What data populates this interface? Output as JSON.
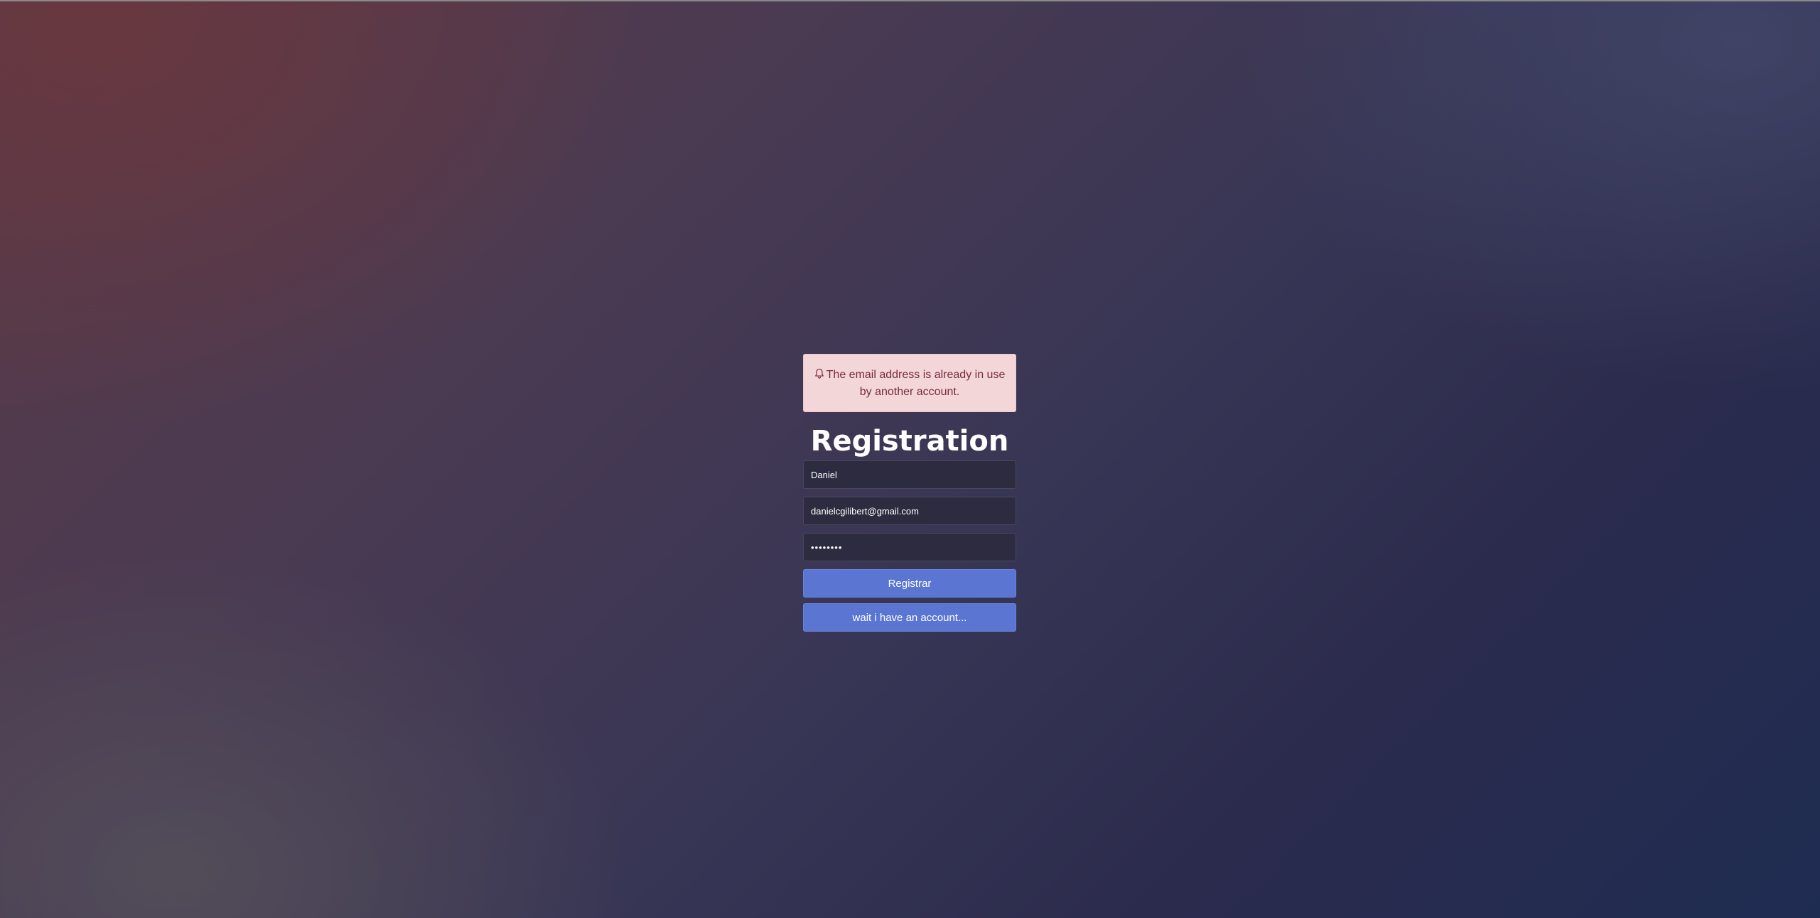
{
  "alert": {
    "icon": "bell-icon",
    "message": "The email address is already in use by another account."
  },
  "form": {
    "title": "Registration",
    "name_value": "Daniel",
    "email_value": "danielcgilibert@gmail.com",
    "password_value": "••••••••",
    "register_label": "Registrar",
    "login_label": "wait i have an account..."
  },
  "colors": {
    "alert_bg": "#f2d6d8",
    "alert_text": "#7a2b3a",
    "button_bg": "#5a76d2",
    "input_bg": "#2d2b3f"
  }
}
